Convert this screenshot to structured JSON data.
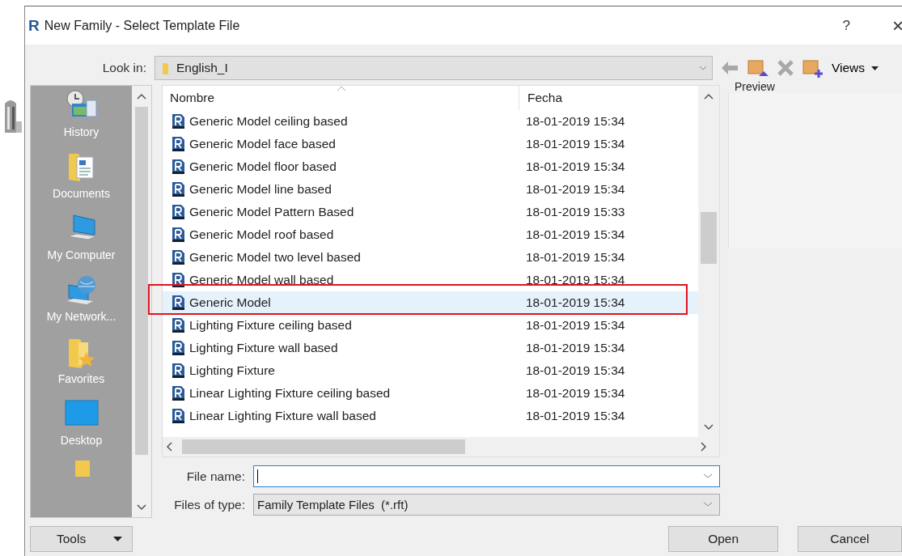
{
  "window": {
    "logo": "R",
    "title": "New Family - Select Template File",
    "help": "?",
    "close": "×"
  },
  "look_in": {
    "label": "Look in:",
    "value": "English_I"
  },
  "toolbar": {
    "views": "Views"
  },
  "places": [
    {
      "kind": "history",
      "label": "History"
    },
    {
      "kind": "documents",
      "label": "Documents"
    },
    {
      "kind": "computer",
      "label": "My Computer"
    },
    {
      "kind": "network",
      "label": "My Network..."
    },
    {
      "kind": "favorites",
      "label": "Favorites"
    },
    {
      "kind": "desktop",
      "label": "Desktop"
    },
    {
      "kind": "folder"
    }
  ],
  "file_list": {
    "columns": [
      "Nombre",
      "Fecha"
    ],
    "rows": [
      {
        "name": "Generic Model ceiling based",
        "date": "18-01-2019 15:34",
        "selected": false
      },
      {
        "name": "Generic Model face based",
        "date": "18-01-2019 15:34",
        "selected": false
      },
      {
        "name": "Generic Model floor based",
        "date": "18-01-2019 15:34",
        "selected": false
      },
      {
        "name": "Generic Model line based",
        "date": "18-01-2019 15:34",
        "selected": false
      },
      {
        "name": "Generic Model Pattern Based",
        "date": "18-01-2019 15:33",
        "selected": false
      },
      {
        "name": "Generic Model roof based",
        "date": "18-01-2019 15:34",
        "selected": false
      },
      {
        "name": "Generic Model two level based",
        "date": "18-01-2019 15:34",
        "selected": false
      },
      {
        "name": "Generic Model wall based",
        "date": "18-01-2019 15:34",
        "selected": false
      },
      {
        "name": "Generic Model",
        "date": "18-01-2019 15:34",
        "selected": true
      },
      {
        "name": "Lighting Fixture ceiling based",
        "date": "18-01-2019 15:34",
        "selected": false
      },
      {
        "name": "Lighting Fixture wall based",
        "date": "18-01-2019 15:34",
        "selected": false
      },
      {
        "name": "Lighting Fixture",
        "date": "18-01-2019 15:34",
        "selected": false
      },
      {
        "name": "Linear Lighting Fixture ceiling based",
        "date": "18-01-2019 15:34",
        "selected": false
      },
      {
        "name": "Linear Lighting Fixture wall based",
        "date": "18-01-2019 15:34",
        "selected": false
      }
    ]
  },
  "highlight_selected": true,
  "preview": {
    "label": "Preview"
  },
  "file_name": {
    "label": "File name:",
    "focused": true
  },
  "files_of_type": {
    "label": "Files of type:",
    "value": "Family Template Files  (*.rft)"
  },
  "buttons": {
    "tools": "Tools",
    "open": "Open",
    "cancel": "Cancel"
  }
}
